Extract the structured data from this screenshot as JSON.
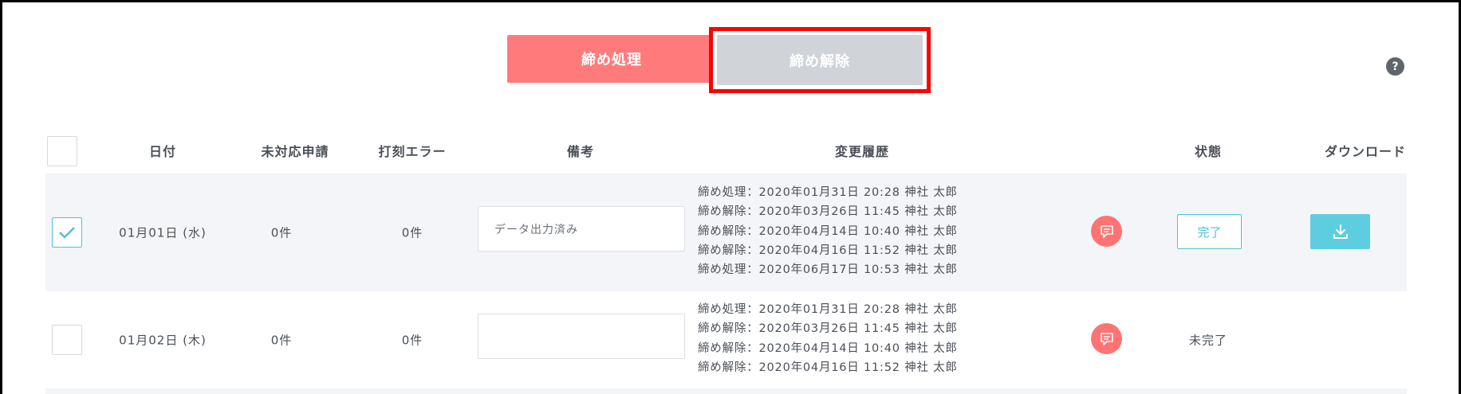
{
  "toolbar": {
    "close_label": "締め処理",
    "release_label": "締め解除",
    "help_label": "?"
  },
  "table": {
    "headers": {
      "date": "日付",
      "pending": "未対応申請",
      "stamp_error": "打刻エラー",
      "note": "備考",
      "history": "変更履歴",
      "status": "状態",
      "download": "ダウンロード"
    },
    "rows": [
      {
        "checked": true,
        "date": "01月01日 (水)",
        "pending": "0件",
        "stamp_error": "0件",
        "note": "データ出力済み",
        "history": [
          "締め処理：2020年01月31日 20:28 神社 太郎",
          "締め解除：2020年03月26日 11:45 神社 太郎",
          "締め解除：2020年04月14日 10:40 神社 太郎",
          "締め解除：2020年04月16日 11:52 神社 太郎",
          "締め処理：2020年06月17日 10:53 神社 太郎"
        ],
        "status": "完了"
      },
      {
        "checked": false,
        "date": "01月02日 (木)",
        "pending": "0件",
        "stamp_error": "0件",
        "note": "",
        "history": [
          "締め処理：2020年01月31日 20:28 神社 太郎",
          "締め解除：2020年03月26日 11:45 神社 太郎",
          "締め解除：2020年04月14日 10:40 神社 太郎",
          "締め解除：2020年04月16日 11:52 神社 太郎"
        ],
        "status": "未完了"
      }
    ]
  },
  "colors": {
    "accent_red": "#ff7b7b",
    "highlight_border": "#ff0000",
    "teal": "#4cc3d8",
    "row_stripe": "#f4f5f8"
  }
}
